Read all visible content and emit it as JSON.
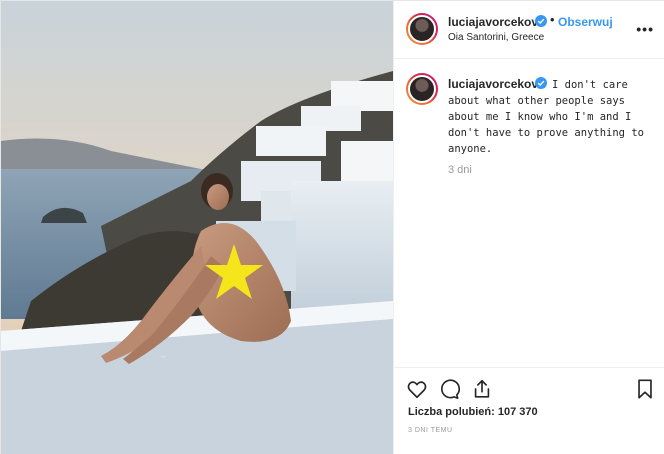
{
  "header": {
    "username": "luciajavorcekova",
    "follow_label": "Obserwuj",
    "separator": "•",
    "location": "Oia Santorini, Greece",
    "more_icon": "•••"
  },
  "caption": {
    "username": "luciajavorcekova",
    "text": "I don't care about what other people says about me I know who I'm and I don't have to prove anything to anyone.",
    "time_ago": "3 dni"
  },
  "footer": {
    "likes_text": "Liczba polubień: 107 370",
    "posted_ago": "3 DNI TEMU"
  },
  "icons": {
    "verified": "verified-badge-icon",
    "like": "heart-icon",
    "comment": "comment-icon",
    "share": "share-icon",
    "save": "bookmark-icon"
  },
  "colors": {
    "link_blue": "#3897f0",
    "verified_blue": "#3897f0",
    "muted": "#999999",
    "censor_star": "#f5e51b"
  }
}
